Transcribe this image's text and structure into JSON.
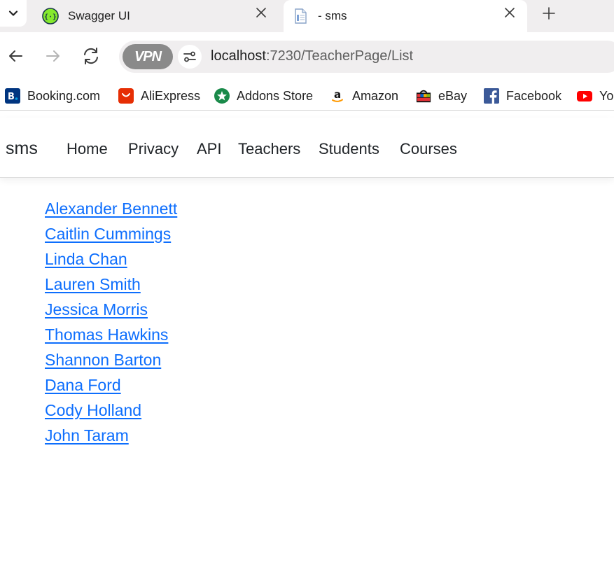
{
  "browser": {
    "tabs": [
      {
        "title": "Swagger UI",
        "favicon": "swagger-icon",
        "active": false
      },
      {
        "title": "- sms",
        "favicon": "document-icon",
        "active": true
      }
    ],
    "address": {
      "host": "localhost",
      "rest": ":7230/TeacherPage/List"
    },
    "vpn_label": "VPN",
    "bookmarks": [
      {
        "label": "Booking.com",
        "icon": "booking-icon"
      },
      {
        "label": "AliExpress",
        "icon": "aliexpress-icon"
      },
      {
        "label": "Addons Store",
        "icon": "addons-store-icon"
      },
      {
        "label": "Amazon",
        "icon": "amazon-icon"
      },
      {
        "label": "eBay",
        "icon": "ebay-icon"
      },
      {
        "label": "Facebook",
        "icon": "facebook-icon"
      },
      {
        "label": "You",
        "icon": "youtube-icon"
      }
    ]
  },
  "site": {
    "brand": "sms",
    "nav": [
      "Home",
      "Privacy",
      "API",
      "Teachers",
      "Students",
      "Courses"
    ]
  },
  "teachers": [
    "Alexander Bennett",
    "Caitlin Cummings",
    "Linda Chan",
    "Lauren Smith",
    "Jessica Morris",
    "Thomas Hawkins",
    "Shannon Barton",
    "Dana Ford",
    "Cody Holland",
    "John Taram"
  ],
  "colors": {
    "link": "#0d6efd",
    "tab_strip": "#f0eeef",
    "omnibox": "#f0eeef",
    "vpn_badge": "#8a8a8a"
  }
}
